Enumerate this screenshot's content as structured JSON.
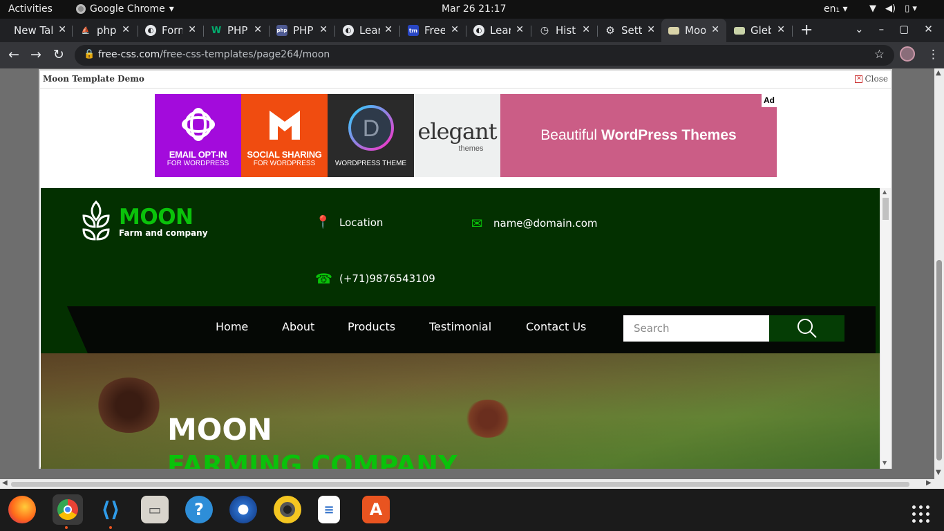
{
  "system": {
    "activities": "Activities",
    "app_name": "Google Chrome",
    "clock": "Mar 26  21:17",
    "lang": "en₁ ▾",
    "tray": [
      "▼",
      "◀)",
      "▯ ▾"
    ]
  },
  "browser": {
    "tabs": [
      {
        "title": "New Tab",
        "icon": "blank"
      },
      {
        "title": "phpMyAdmin",
        "icon": "phpmyadmin-icon"
      },
      {
        "title": "Forms",
        "icon": "globe-icon"
      },
      {
        "title": "PHP",
        "icon": "w-icon"
      },
      {
        "title": "PHP",
        "icon": "php-icon"
      },
      {
        "title": "Learn",
        "icon": "globe-icon"
      },
      {
        "title": "Free",
        "icon": "tm-icon"
      },
      {
        "title": "Learn",
        "icon": "globe-icon"
      },
      {
        "title": "History",
        "icon": "history-icon"
      },
      {
        "title": "Settings",
        "icon": "gear-icon"
      },
      {
        "title": "Moon",
        "icon": "template-icon",
        "active": true
      },
      {
        "title": "Gleb",
        "icon": "template-icon"
      }
    ],
    "url_host": "free-css.com",
    "url_path": "/free-css-templates/page264/moon"
  },
  "demo": {
    "title": "Moon Template Demo",
    "close": "Close"
  },
  "ad": {
    "tile1_big": "EMAIL OPT-IN",
    "tile1_small": "FOR WORDPRESS",
    "tile2_big": "SOCIAL SHARING",
    "tile2_small": "FOR WORDPRESS",
    "tile3_small": "WORDPRESS THEME",
    "tile4_word": "elegant",
    "tile4_sub": "themes",
    "headline_plain": "Beautiful",
    "headline_bold": "WordPress Themes",
    "label": "Ad"
  },
  "site": {
    "brand": "MOON",
    "tagline": "Farm and company",
    "location": "Location",
    "email": "name@domain.com",
    "phone": "(+71)9876543109",
    "nav": [
      "Home",
      "About",
      "Products",
      "Testimonial",
      "Contact Us"
    ],
    "search_placeholder": "Search",
    "hero_title": "MOON",
    "hero_subtitle": "FARMING COMPANY",
    "accent": "#0ac20a",
    "header_bg": "#033000"
  },
  "dock": [
    "firefox-icon",
    "chrome-icon",
    "vscode-icon",
    "files-icon",
    "help-icon",
    "thunderbird-icon",
    "rhythmbox-icon",
    "writer-icon",
    "app-store-icon"
  ]
}
